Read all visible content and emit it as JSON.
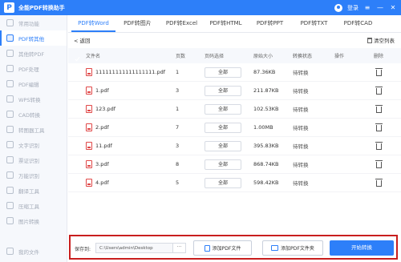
{
  "app": {
    "title": "全能PDF转换助手",
    "logo_text": "P",
    "login_label": "登录"
  },
  "window_controls": {
    "menu": "≡",
    "minimize": "—",
    "close": "✕"
  },
  "sidebar": {
    "items": [
      {
        "label": "常用功能",
        "active": false
      },
      {
        "label": "PDF转其他",
        "active": true
      },
      {
        "label": "其他转PDF",
        "active": false
      },
      {
        "label": "PDF处理",
        "active": false
      },
      {
        "label": "PDF编辑",
        "active": false
      },
      {
        "label": "WPS转换",
        "active": false
      },
      {
        "label": "CAD转换",
        "active": false
      },
      {
        "label": "转图器工具",
        "active": false
      },
      {
        "label": "文字识别",
        "active": false
      },
      {
        "label": "票证识别",
        "active": false
      },
      {
        "label": "万能识别",
        "active": false
      },
      {
        "label": "翻译工具",
        "active": false
      },
      {
        "label": "压缩工具",
        "active": false
      },
      {
        "label": "图片转换",
        "active": false
      }
    ],
    "bottom_label": "我的文件"
  },
  "tabs": [
    {
      "label": "PDF转Word",
      "active": true
    },
    {
      "label": "PDF转图片",
      "active": false
    },
    {
      "label": "PDF转Excel",
      "active": false
    },
    {
      "label": "PDF转HTML",
      "active": false
    },
    {
      "label": "PDF转PPT",
      "active": false
    },
    {
      "label": "PDF转TXT",
      "active": false
    },
    {
      "label": "PDF转CAD",
      "active": false
    }
  ],
  "toolbar": {
    "back_label": "< 返回",
    "clear_label": "清空列表"
  },
  "table": {
    "headers": {
      "name": "文件名",
      "pages": "页数",
      "range": "页码选择",
      "size": "原始大小",
      "status": "转换状态",
      "op": "操作",
      "del": "删除"
    },
    "rows": [
      {
        "name": "111111111111111111.pdf",
        "pages": "1",
        "range": "全部",
        "size": "87.36KB",
        "status": "待转换"
      },
      {
        "name": "1.pdf",
        "pages": "3",
        "range": "全部",
        "size": "211.87KB",
        "status": "待转换"
      },
      {
        "name": "123.pdf",
        "pages": "1",
        "range": "全部",
        "size": "102.53KB",
        "status": "待转换"
      },
      {
        "name": "2.pdf",
        "pages": "7",
        "range": "全部",
        "size": "1.00MB",
        "status": "待转换"
      },
      {
        "name": "11.pdf",
        "pages": "3",
        "range": "全部",
        "size": "395.83KB",
        "status": "待转换"
      },
      {
        "name": "3.pdf",
        "pages": "8",
        "range": "全部",
        "size": "868.74KB",
        "status": "待转换"
      },
      {
        "name": "4.pdf",
        "pages": "5",
        "range": "全部",
        "size": "598.42KB",
        "status": "待转换"
      }
    ]
  },
  "bottom": {
    "save_label": "保存到:",
    "path_value": "C:\\Users\\admin\\Desktop",
    "more_label": "···",
    "add_file_label": "添加PDF文件",
    "add_folder_label": "添加PDF文件夹",
    "start_label": "开始转换"
  },
  "colors": {
    "accent": "#2d7ff9",
    "highlight_frame": "#c81e1e",
    "pdf_icon": "#e04848"
  }
}
